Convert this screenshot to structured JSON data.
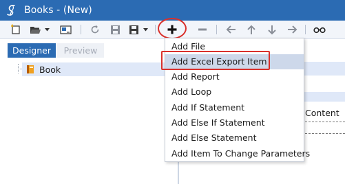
{
  "window": {
    "title": "Books - (New)",
    "titlebar_color": "#2b6bb3",
    "logo_icon": "script-s-logo-icon"
  },
  "toolbar": {
    "icons": [
      "new-item-icon",
      "open-folder-icon",
      "dropdown-arrow-icon",
      "template-icon",
      "refresh-icon",
      "save-icon",
      "save-as-icon",
      "dropdown-arrow-icon",
      "add-icon",
      "remove-icon",
      "arrow-left-icon",
      "arrow-up-icon",
      "arrow-down-icon",
      "arrow-right-icon",
      "glasses-icon"
    ],
    "highlight_color": "#d9302b"
  },
  "tabs": [
    {
      "label": "Designer",
      "active": true
    },
    {
      "label": "Preview",
      "active": false
    }
  ],
  "tree": {
    "root": {
      "label": "Book",
      "icon": "book-icon"
    }
  },
  "right_pane": {
    "column_header": "Content"
  },
  "add_menu": {
    "items": [
      {
        "label": "Add File"
      },
      {
        "label": "Add Excel Export Item",
        "selected": true
      },
      {
        "label": "Add Report"
      },
      {
        "label": "Add Loop"
      },
      {
        "label": "Add If Statement"
      },
      {
        "label": "Add Else If Statement"
      },
      {
        "label": "Add Else Statement"
      },
      {
        "label": "Add Item To Change Parameters"
      }
    ]
  }
}
